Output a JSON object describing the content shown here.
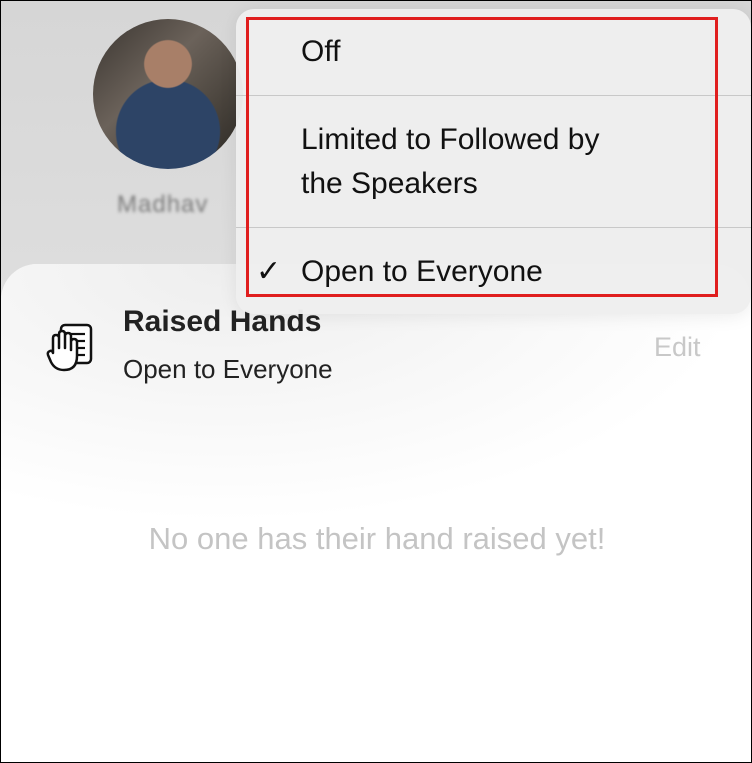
{
  "background": {
    "speaker_name": "Madhav"
  },
  "sheet": {
    "title": "Raised Hands",
    "subtitle": "Open to Everyone",
    "edit_label": "Edit",
    "empty_message": "No one has their hand raised yet!",
    "icon": "raised-hand-icon"
  },
  "menu": {
    "items": [
      {
        "label": "Off",
        "selected": false
      },
      {
        "label": "Limited to Followed by the Speakers",
        "line1": "Limited to Followed by",
        "line2": "the Speakers",
        "selected": false
      },
      {
        "label": "Open to Everyone",
        "selected": true
      }
    ],
    "check_glyph": "✓",
    "highlight_color": "#e01e1e"
  }
}
